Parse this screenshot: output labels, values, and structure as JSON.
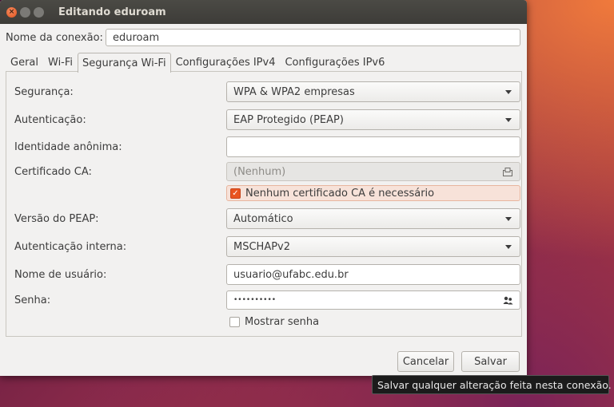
{
  "window": {
    "title": "Editando eduroam"
  },
  "connection": {
    "label": "Nome da conexão:",
    "value": "eduroam"
  },
  "tabs": [
    {
      "label": "Geral"
    },
    {
      "label": "Wi-Fi"
    },
    {
      "label": "Segurança Wi-Fi",
      "active": true
    },
    {
      "label": "Configurações IPv4"
    },
    {
      "label": "Configurações IPv6"
    }
  ],
  "form": {
    "security": {
      "label": "Segurança:",
      "value": "WPA & WPA2 empresas"
    },
    "authentication": {
      "label": "Autenticação:",
      "value": "EAP Protegido (PEAP)"
    },
    "anonymous_identity": {
      "label": "Identidade anônima:",
      "value": ""
    },
    "ca_certificate": {
      "label": "Certificado CA:",
      "value": "(Nenhum)",
      "icon": "file-chooser-icon"
    },
    "no_ca_required": {
      "label": "Nenhum certificado CA é necessário",
      "checked": true
    },
    "peap_version": {
      "label": "Versão do PEAP:",
      "value": "Automático"
    },
    "inner_auth": {
      "label": "Autenticação interna:",
      "value": "MSCHAPv2"
    },
    "username": {
      "label": "Nome de usuário:",
      "value": "usuario@ufabc.edu.br"
    },
    "password": {
      "label": "Senha:",
      "value": "••••••••••",
      "icon": "users-icon"
    },
    "show_password": {
      "label": "Mostrar senha",
      "checked": false
    }
  },
  "buttons": {
    "cancel": "Cancelar",
    "save": "Salvar"
  },
  "tooltip": {
    "text": "Salvar qualquer alteração feita nesta conexão."
  },
  "colors": {
    "accent": "#e95420",
    "titlebar": "#3d3c38",
    "window_bg": "#f2f1f0"
  }
}
